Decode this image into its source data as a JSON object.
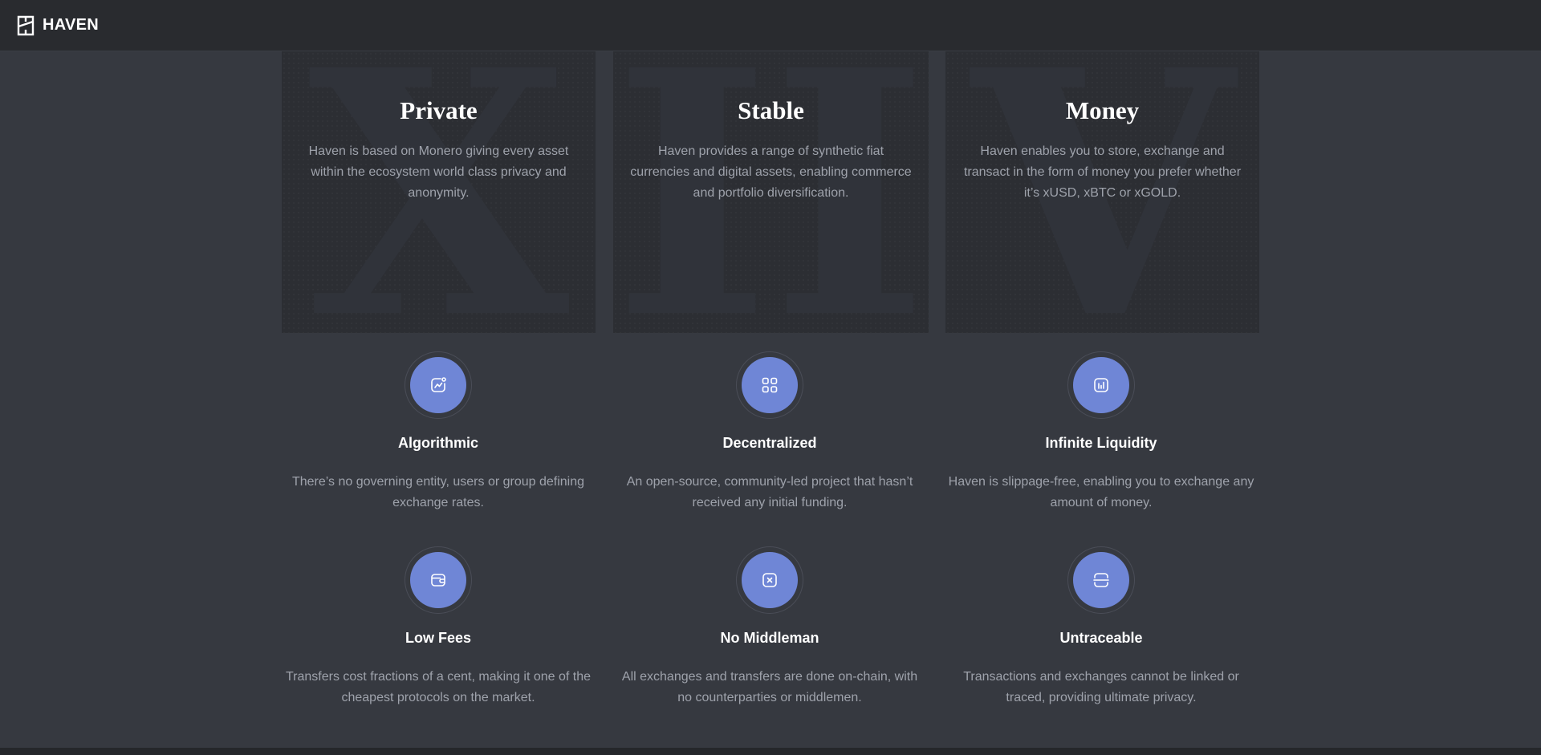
{
  "nav": {
    "brand": "HAVEN",
    "logo_icon": "haven-logo-icon"
  },
  "cards": [
    {
      "numeral": "X",
      "title": "Private",
      "text": "Haven is based on Monero giving every asset within the ecosystem world class privacy and anonymity."
    },
    {
      "numeral": "III",
      "title": "Stable",
      "text": "Haven provides a range of synthetic fiat currencies and digital assets, enabling commerce and portfolio diversification."
    },
    {
      "numeral": "V",
      "title": "Money",
      "text": "Haven enables you to store, exchange and transact in the form of money you prefer whether it’s xUSD, xBTC or xGOLD."
    }
  ],
  "features": [
    {
      "icon": "chart-trend-icon",
      "title": "Algorithmic",
      "text": "There’s no governing entity, users or group defining exchange rates."
    },
    {
      "icon": "grid-icon",
      "title": "Decentralized",
      "text": "An open-source, community-led project that hasn’t received any initial funding."
    },
    {
      "icon": "bar-chart-icon",
      "title": "Infinite Liquidity",
      "text": "Haven is slippage-free, enabling you to exchange any amount of money."
    },
    {
      "icon": "wallet-icon",
      "title": "Low Fees",
      "text": "Transfers cost fractions of a cent, making it one of the cheapest protocols on the market."
    },
    {
      "icon": "close-box-icon",
      "title": "No Middleman",
      "text": "All exchanges and transfers are done on-chain, with no counterparties or middlemen."
    },
    {
      "icon": "scan-icon",
      "title": "Untraceable",
      "text": "Transactions and exchanges cannot be linked or traced, providing ultimate privacy."
    }
  ],
  "colors": {
    "background": "#363940",
    "navbar": "#292b2f",
    "card": "#2c2e33",
    "accent": "#6f86d6",
    "muted_text": "#9ea2ab"
  }
}
